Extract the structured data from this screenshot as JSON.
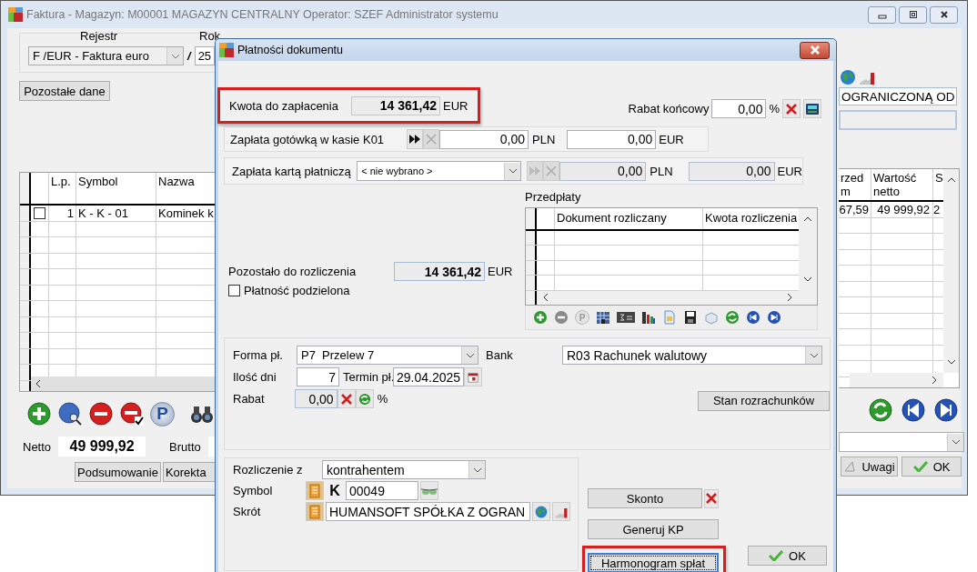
{
  "main_window": {
    "title": "Faktura - Magazyn: M00001 MAGAZYN CENTRALNY  Operator: SZEF Administrator systemu",
    "register_label": "Rejestr",
    "register_value": "F /EUR - Faktura euro",
    "slash": "/",
    "year_label": "Rok",
    "year_value": "25",
    "other_data_button": "Pozostałe dane",
    "client_value": "OGRANICZONĄ OD",
    "table": {
      "left_columns": [
        "L.p.",
        "Symbol",
        "Nazwa"
      ],
      "right_columns": [
        "rzed m",
        "Wartość netto",
        "S"
      ],
      "rows": [
        {
          "checked": false,
          "lp": "1",
          "symbol": "K - K - 01",
          "name": "Kominek k",
          "price": "67,59",
          "net": "49 999,92",
          "col_s": "2"
        }
      ]
    },
    "toolbar_p": "P",
    "netto_label": "Netto",
    "netto_value": "49 999,92",
    "brutto_label": "Brutto",
    "bottom_buttons": [
      "Podsumowanie",
      "Korekta"
    ],
    "notes_button": "Uwagi",
    "ok_button": "OK"
  },
  "dialog": {
    "title": "Płatności dokumentu",
    "amount": {
      "label": "Kwota do zapłacenia",
      "value": "14 361,42",
      "currency": "EUR",
      "highlighted": true
    },
    "final_discount": {
      "label": "Rabat końcowy",
      "value": "0,00",
      "unit": "%"
    },
    "payments": [
      {
        "label": "Zapłata gotówką w kasie K01",
        "kind": "cash",
        "disabled": false,
        "pln": "0,00",
        "pln_currency": "PLN",
        "eur": "0,00",
        "eur_currency": "EUR"
      },
      {
        "label": "Zapłata kartą płatniczą",
        "kind": "card",
        "selector": "< nie wybrano >",
        "disabled": true,
        "pln": "0,00",
        "pln_currency": "PLN",
        "eur": "0,00",
        "eur_currency": "EUR"
      }
    ],
    "remaining": {
      "label": "Pozostało do rozliczenia",
      "value": "14 361,42",
      "currency": "EUR"
    },
    "split_payment": {
      "label": "Płatność podzielona",
      "checked": false
    },
    "prepayments": {
      "title": "Przedpłaty",
      "columns": [
        "Dokument rozliczany",
        "Kwota rozliczenia"
      ],
      "toolbar_p": "P"
    },
    "payment_form": {
      "form_label": "Forma pł.",
      "form_value": "P7  Przelew 7",
      "bank_label": "Bank",
      "bank_value": "R03 Rachunek walutowy",
      "days_label": "Ilość dni",
      "days_value": "7",
      "due_label": "Termin pł.",
      "due_value": "29.04.2025",
      "discount_label": "Rabat",
      "discount_value": "0,00",
      "discount_unit": "%",
      "balance_button": "Stan rozrachunków"
    },
    "settlement": {
      "with_label": "Rozliczenie z",
      "with_value": "kontrahentem",
      "symbol_label": "Symbol",
      "symbol_prefix": "K",
      "symbol_value": "00049",
      "short_label": "Skrót",
      "short_value": "HUMANSOFT SPÓŁKA Z OGRAN"
    },
    "side_buttons": [
      {
        "label": "Skonto",
        "clearable": true,
        "highlighted": false
      },
      {
        "label": "Generuj KP",
        "clearable": false,
        "highlighted": false
      },
      {
        "label": "Harmonogram spłat",
        "clearable": false,
        "highlighted": true
      }
    ],
    "ok_button": "OK"
  }
}
